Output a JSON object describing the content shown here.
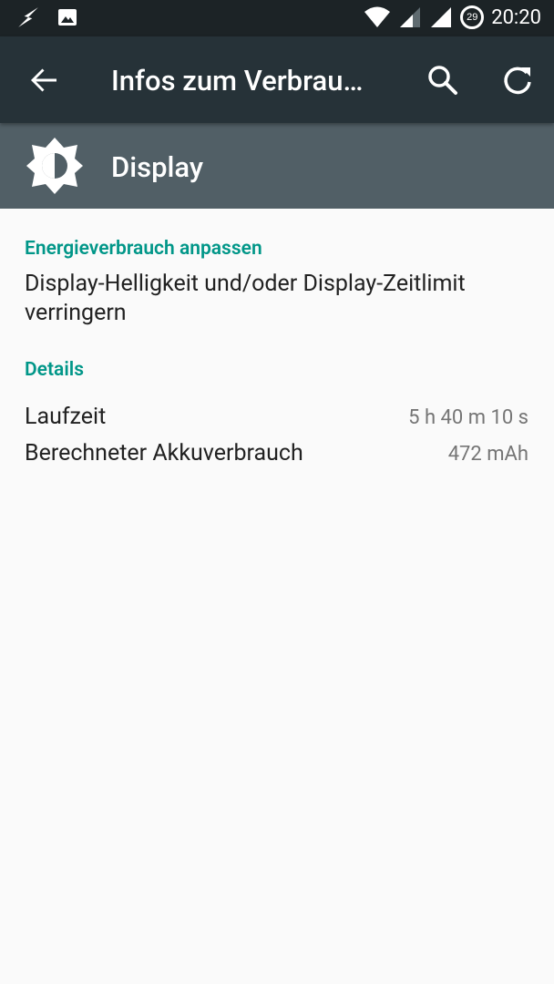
{
  "status_bar": {
    "time": "20:20",
    "battery_level": "29",
    "icons": [
      "flash-icon",
      "image-icon",
      "wifi-icon",
      "signal-icon",
      "signal-icon",
      "battery-icon"
    ]
  },
  "toolbar": {
    "title": "Infos zum Verbrau…",
    "icons": [
      "back-arrow-icon",
      "search-icon",
      "refresh-icon"
    ]
  },
  "header": {
    "title": "Display",
    "icon": "brightness-icon"
  },
  "sections": {
    "adjust": {
      "title": "Energieverbrauch anpassen",
      "text": "Display-Helligkeit und/oder Display-Zeitlimit verringern"
    },
    "details": {
      "title": "Details",
      "rows": [
        {
          "label": "Laufzeit",
          "value": "5 h 40 m 10 s"
        },
        {
          "label": "Berechneter Akkuverbrauch",
          "value": "472 mAh"
        }
      ]
    }
  },
  "colors": {
    "status_bar": "#1c2326",
    "toolbar": "#263238",
    "header": "#515f66",
    "accent": "#009688",
    "background": "#fafafa"
  }
}
